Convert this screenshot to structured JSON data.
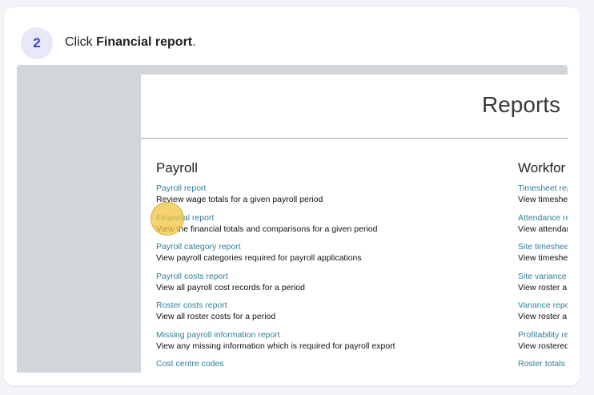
{
  "step": {
    "number": "2",
    "instruction_prefix": "Click ",
    "instruction_target": "Financial report",
    "instruction_suffix": "."
  },
  "screenshot": {
    "page_title": "Reports",
    "sections": {
      "payroll": {
        "title": "Payroll",
        "items": [
          {
            "link": "Payroll report",
            "desc": "Review wage totals for a given payroll period"
          },
          {
            "link": "Financial report",
            "desc": "View the financial totals and comparisons for a given period"
          },
          {
            "link": "Payroll category report",
            "desc": "View payroll categories required for payroll applications"
          },
          {
            "link": "Payroll costs report",
            "desc": "View all payroll cost records for a period"
          },
          {
            "link": "Roster costs report",
            "desc": "View all roster costs for a period"
          },
          {
            "link": "Missing payroll information report",
            "desc": "View any missing information which is required for payroll export"
          },
          {
            "link": "Cost centre codes",
            "desc": ""
          }
        ]
      },
      "workforce": {
        "title": "Workfor",
        "items": [
          {
            "link": "Timesheet rep",
            "desc": "View timeshe"
          },
          {
            "link": "Attendance re",
            "desc": "View attendan"
          },
          {
            "link": "Site timeshee",
            "desc": "View timeshe"
          },
          {
            "link": "Site variance",
            "desc": "View roster a"
          },
          {
            "link": "Variance repo",
            "desc": "View roster a"
          },
          {
            "link": "Profitability re",
            "desc": "View rostered"
          },
          {
            "link": "Roster totals",
            "desc": ""
          }
        ]
      }
    }
  }
}
